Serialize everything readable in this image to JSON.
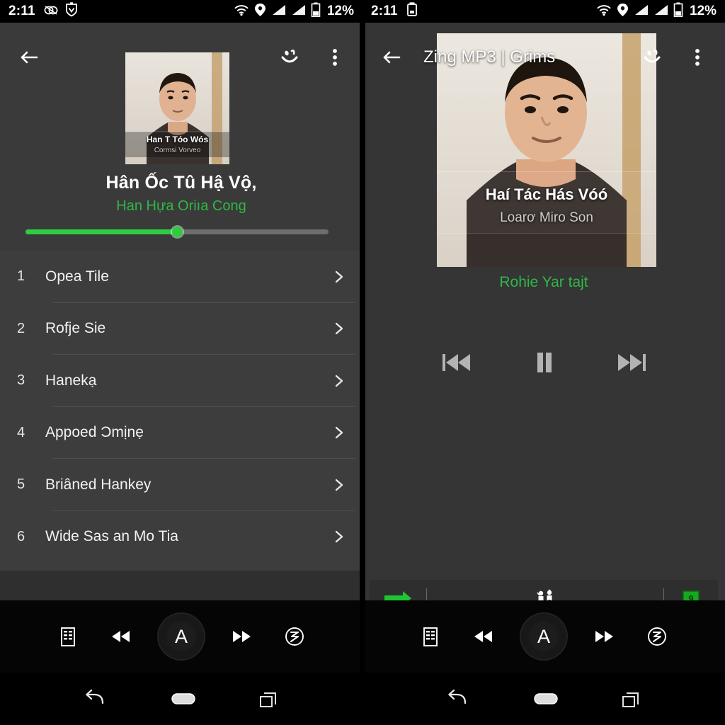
{
  "status_bar": {
    "time": "2:11",
    "battery_percent": "12%",
    "left_icons_left_panel": [
      "alarm-snooze-icon",
      "shield-check-icon"
    ],
    "left_icons_right_panel": [
      "clipboard-icon"
    ],
    "right_icons": [
      "wifi-icon",
      "location-pin-icon",
      "signal-bars-icon",
      "signal-bars-2-icon",
      "battery-icon"
    ]
  },
  "colors": {
    "accent_green": "#2ecc40",
    "artist_green": "#2fb846",
    "app_bg": "#353535",
    "list_bg": "#3d3d3d",
    "hero_bg": "#3a3a3a",
    "bar_black": "#000000"
  },
  "left_panel": {
    "toolbar": {
      "back_icon": "arrow-left-icon",
      "title": "",
      "smiley_icon": "smiley-face-icon",
      "overflow_icon": "overflow-menu-icon"
    },
    "album_art": {
      "overlay_title": "Han T Tóo Wós",
      "overlay_subtitle": "Cormsi Vorveo"
    },
    "now_playing": {
      "title": "Hân Ốc Tû Hậ Vộ,",
      "artist": "Han Hựa Oriıa Cong"
    },
    "progress": {
      "percent": 50
    },
    "tracks": [
      {
        "num": "1",
        "name": "Opea Tile",
        "chevron": "chevron-right-icon"
      },
      {
        "num": "2",
        "name": "Rofje Sie",
        "chevron": "chevron-right-icon"
      },
      {
        "num": "3",
        "name": "Hanekạ",
        "chevron": "chevron-right-icon"
      },
      {
        "num": "4",
        "name": "Appoed Ɔmịnẹ",
        "chevron": "chevron-right-icon"
      },
      {
        "num": "5",
        "name": "Briâned Hankey",
        "chevron": "chevron-right-icon"
      },
      {
        "num": "6",
        "name": "Wide Sas an Mo Tia",
        "chevron": "chevron-right-icon"
      }
    ]
  },
  "right_panel": {
    "toolbar": {
      "back_icon": "arrow-left-icon",
      "title": "Zing MP3 | Grims",
      "smiley_icon": "smiley-face-icon",
      "overflow_icon": "overflow-menu-icon"
    },
    "album_art": {
      "overlay_title": "Haí Tác Hás Vóó",
      "overlay_subtitle": "Loarơ Miro Son"
    },
    "now_playing": {
      "artist": "Rohie Yar tajt"
    },
    "controls": {
      "previous": "skip-previous-icon",
      "play_pause": "pause-icon",
      "next": "skip-next-icon"
    },
    "bottom_bar": {
      "arrow_icon": "green-arrow-right-icon",
      "people_icon": "two-people-icon",
      "badge_icon": "green-shield-badge-icon",
      "badge_label": "9"
    }
  },
  "media_tray": {
    "buttons": [
      {
        "icon": "playlist-icon",
        "label": ""
      },
      {
        "icon": "rewind-icon",
        "label": ""
      },
      {
        "icon": "home-circle-icon",
        "label": "A"
      },
      {
        "icon": "fast-forward-icon",
        "label": ""
      },
      {
        "icon": "shuffle-circle-icon",
        "label": ""
      }
    ]
  },
  "nav_bar": {
    "buttons": [
      {
        "icon": "back-arrow-icon"
      },
      {
        "icon": "home-pill-icon"
      },
      {
        "icon": "recents-icon"
      }
    ]
  }
}
